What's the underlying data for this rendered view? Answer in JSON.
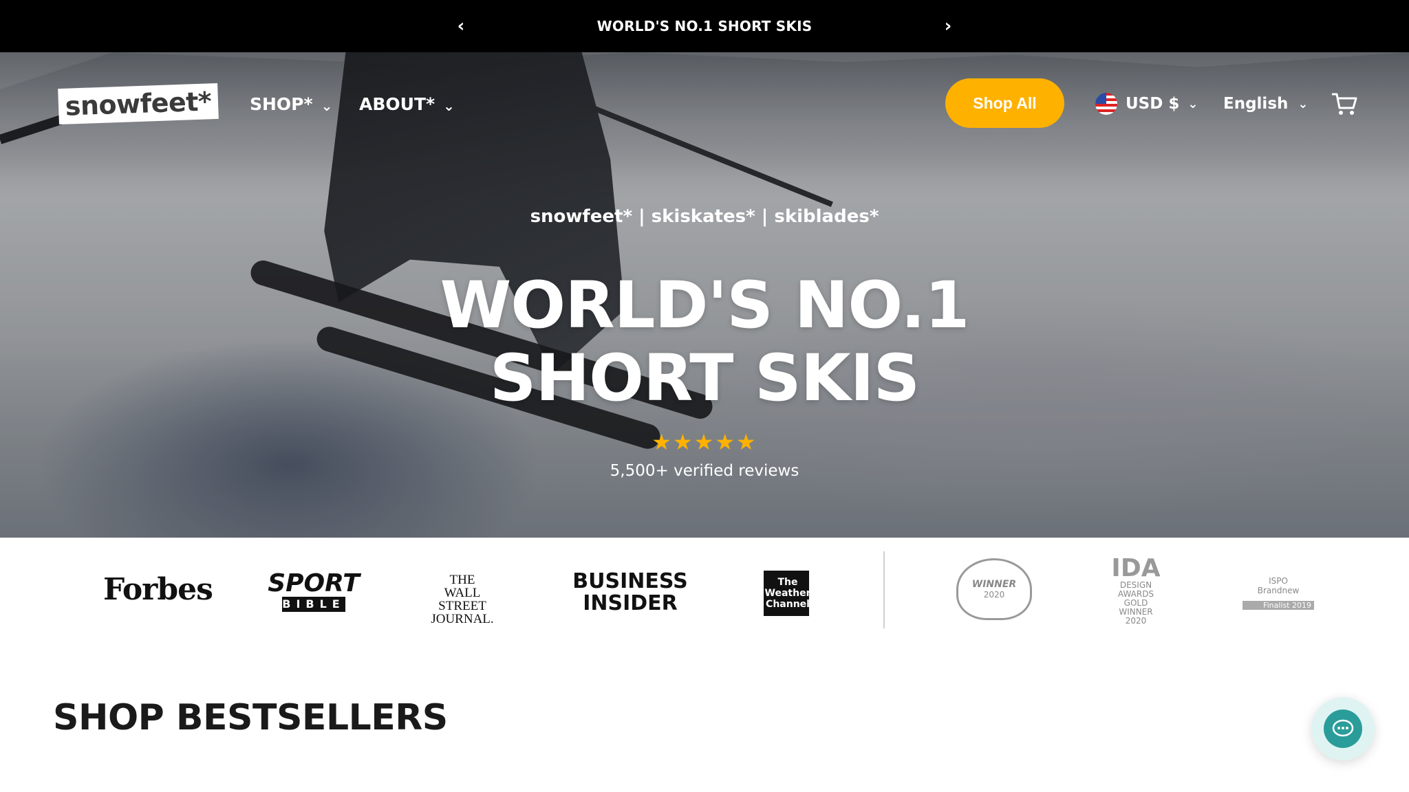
{
  "announcement": {
    "text": "WORLD'S NO.1 SHORT SKIS",
    "prev_icon": "chevron-left-icon",
    "next_icon": "chevron-right-icon"
  },
  "header": {
    "logo_text": "snowfeet*",
    "nav": [
      {
        "label": "SHOP*"
      },
      {
        "label": "ABOUT*"
      }
    ],
    "shop_all_label": "Shop All",
    "currency_label": "USD $",
    "language_label": "English",
    "cart_icon": "cart-icon"
  },
  "hero": {
    "tagline": "snowfeet* | skiskates* | skiblades*",
    "headline_line1": "WORLD'S NO.1",
    "headline_line2": "SHORT SKIS",
    "rating": 5,
    "reviews_text": "5,500+ verified reviews"
  },
  "press": {
    "forbes": "Forbes",
    "sportbible_top": "SPORT",
    "sportbible_bottom": "BIBLE",
    "wsj_line1": "THE",
    "wsj_line2": "WALL STREET",
    "wsj_line3": "JOURNAL.",
    "bi_line1": "BUSINESS",
    "bi_line2": "INSIDER",
    "twc_line1": "The",
    "twc_line2": "Weather",
    "twc_line3": "Channel",
    "award1_title": "WINNER",
    "award1_year": "2020",
    "award2_title": "IDA",
    "award2_line1": "DESIGN",
    "award2_line2": "AWARDS",
    "award2_line3": "GOLD",
    "award2_line4": "WINNER",
    "award2_line5": "2020",
    "award3_line1": "ISPO",
    "award3_line2": "Brandnew",
    "award3_bar": "Finalist 2019"
  },
  "section": {
    "title": "SHOP BESTSELLERS"
  },
  "colors": {
    "accent": "#ffb100",
    "announcement_bg": "#000000",
    "chat_bg": "#2a9d9a"
  }
}
